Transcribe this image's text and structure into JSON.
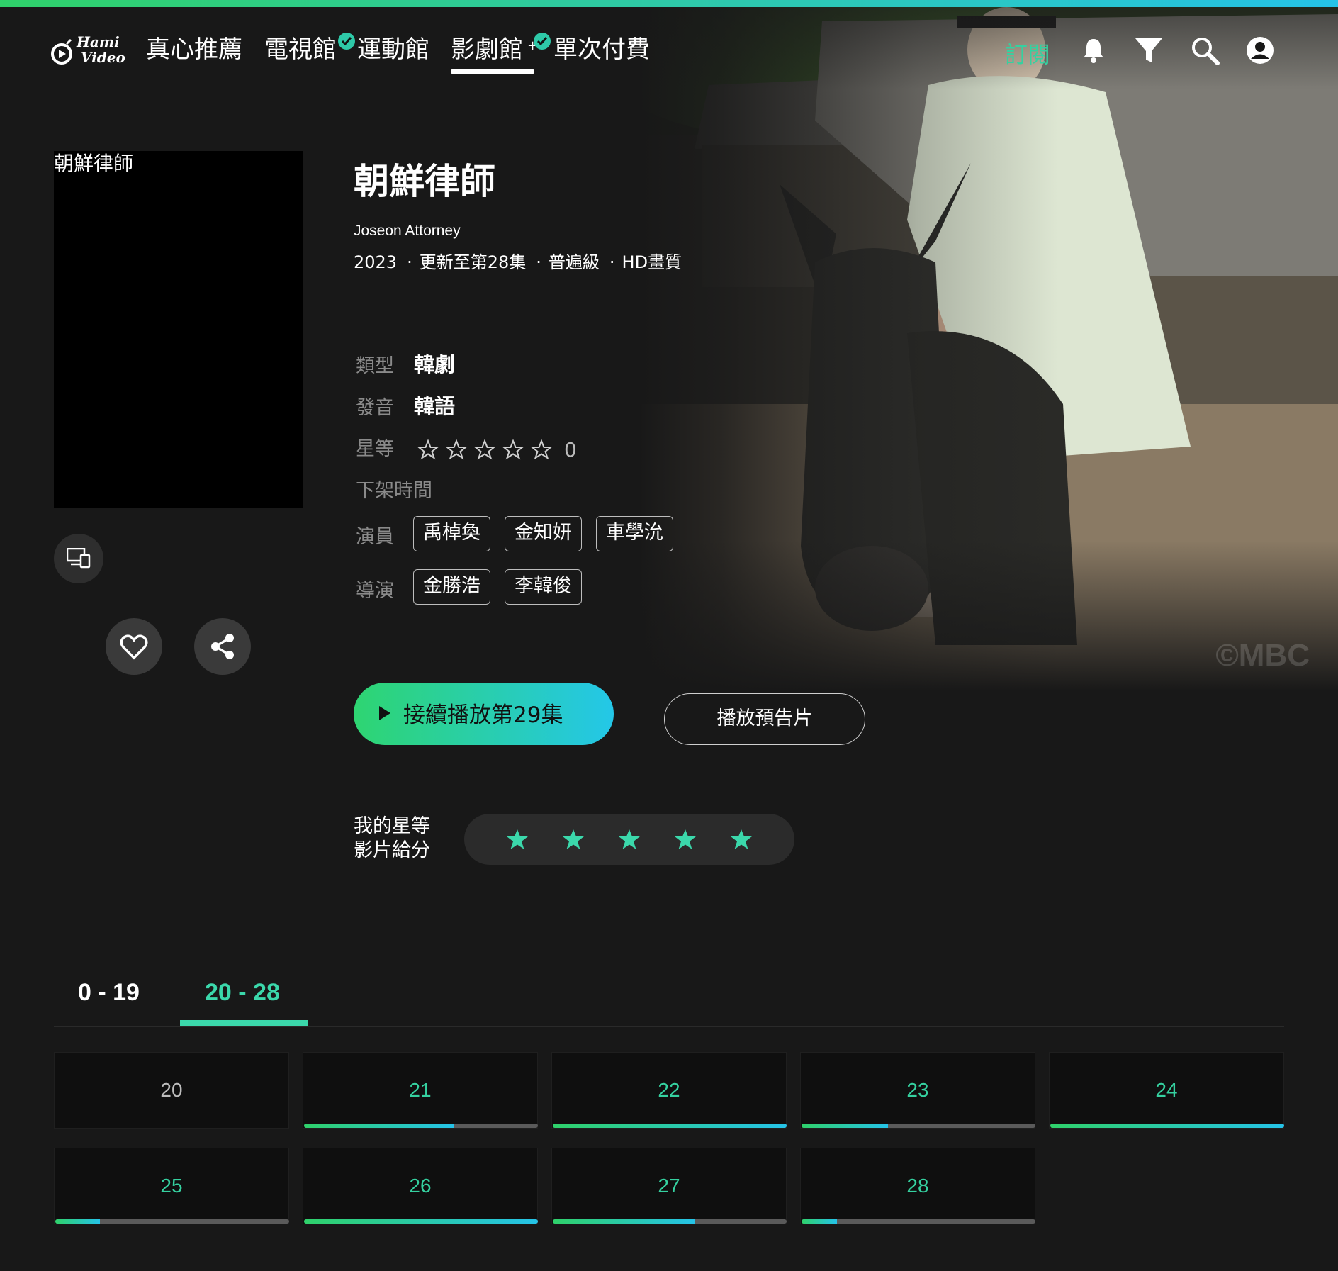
{
  "brand": {
    "logo_text_line1": "Hami",
    "logo_text_line2": "Video",
    "accent": "#35d1a0",
    "gradient_start": "#2fd16a",
    "gradient_end": "#25c3e8"
  },
  "nav": {
    "items": [
      {
        "label": "真心推薦",
        "badge": false,
        "active": false
      },
      {
        "label": "電視館",
        "badge": true,
        "active": false
      },
      {
        "label": "運動館",
        "badge": false,
        "active": false
      },
      {
        "label": "影劇館",
        "badge": true,
        "active": true,
        "suffix": "+"
      },
      {
        "label": "單次付費",
        "badge": false,
        "active": false
      }
    ],
    "subscribe_label": "訂閱",
    "icons": [
      "bell-icon",
      "filter-icon",
      "search-icon",
      "account-icon"
    ]
  },
  "poster": {
    "alt_text": "朝鮮律師",
    "watermark": "©MBC"
  },
  "show": {
    "title": "朝鮮律師",
    "subtitle": "Joseon Attorney",
    "year": "2023",
    "update_status": "更新至第28集",
    "rating_level": "普遍級",
    "quality": "HD畫質",
    "meta_separator": "·",
    "genre_label": "類型",
    "genre": "韓劇",
    "audio_label": "發音",
    "audio": "韓語",
    "stars_label": "星等",
    "stars_value": 0,
    "stars_count": "0",
    "removal_label": "下架時間",
    "cast_label": "演員",
    "cast": [
      "禹棹奐",
      "金知妍",
      "車學沇"
    ],
    "director_label": "導演",
    "directors": [
      "金勝浩",
      "李韓俊"
    ]
  },
  "actions": {
    "play_label": "接續播放第29集",
    "trailer_label": "播放預告片",
    "favorite_icon": "heart-icon",
    "share_icon": "share-icon",
    "device_icon": "devices-icon"
  },
  "my_rating": {
    "line1": "我的星等",
    "line2": "影片給分",
    "star_color": "#3bd8ab",
    "stars": 5
  },
  "episodes": {
    "tabs": [
      {
        "label": "0 - 19",
        "active": false
      },
      {
        "label": "20 - 28",
        "active": true
      }
    ],
    "items": [
      {
        "number": "20",
        "progress": 0,
        "watched": false
      },
      {
        "number": "21",
        "progress": 0.64,
        "watched": true
      },
      {
        "number": "22",
        "progress": 1.0,
        "watched": true
      },
      {
        "number": "23",
        "progress": 0.37,
        "watched": true
      },
      {
        "number": "24",
        "progress": 1.0,
        "watched": true
      },
      {
        "number": "25",
        "progress": 0.19,
        "watched": true
      },
      {
        "number": "26",
        "progress": 1.0,
        "watched": true
      },
      {
        "number": "27",
        "progress": 0.61,
        "watched": true
      },
      {
        "number": "28",
        "progress": 0.15,
        "watched": true
      }
    ]
  }
}
